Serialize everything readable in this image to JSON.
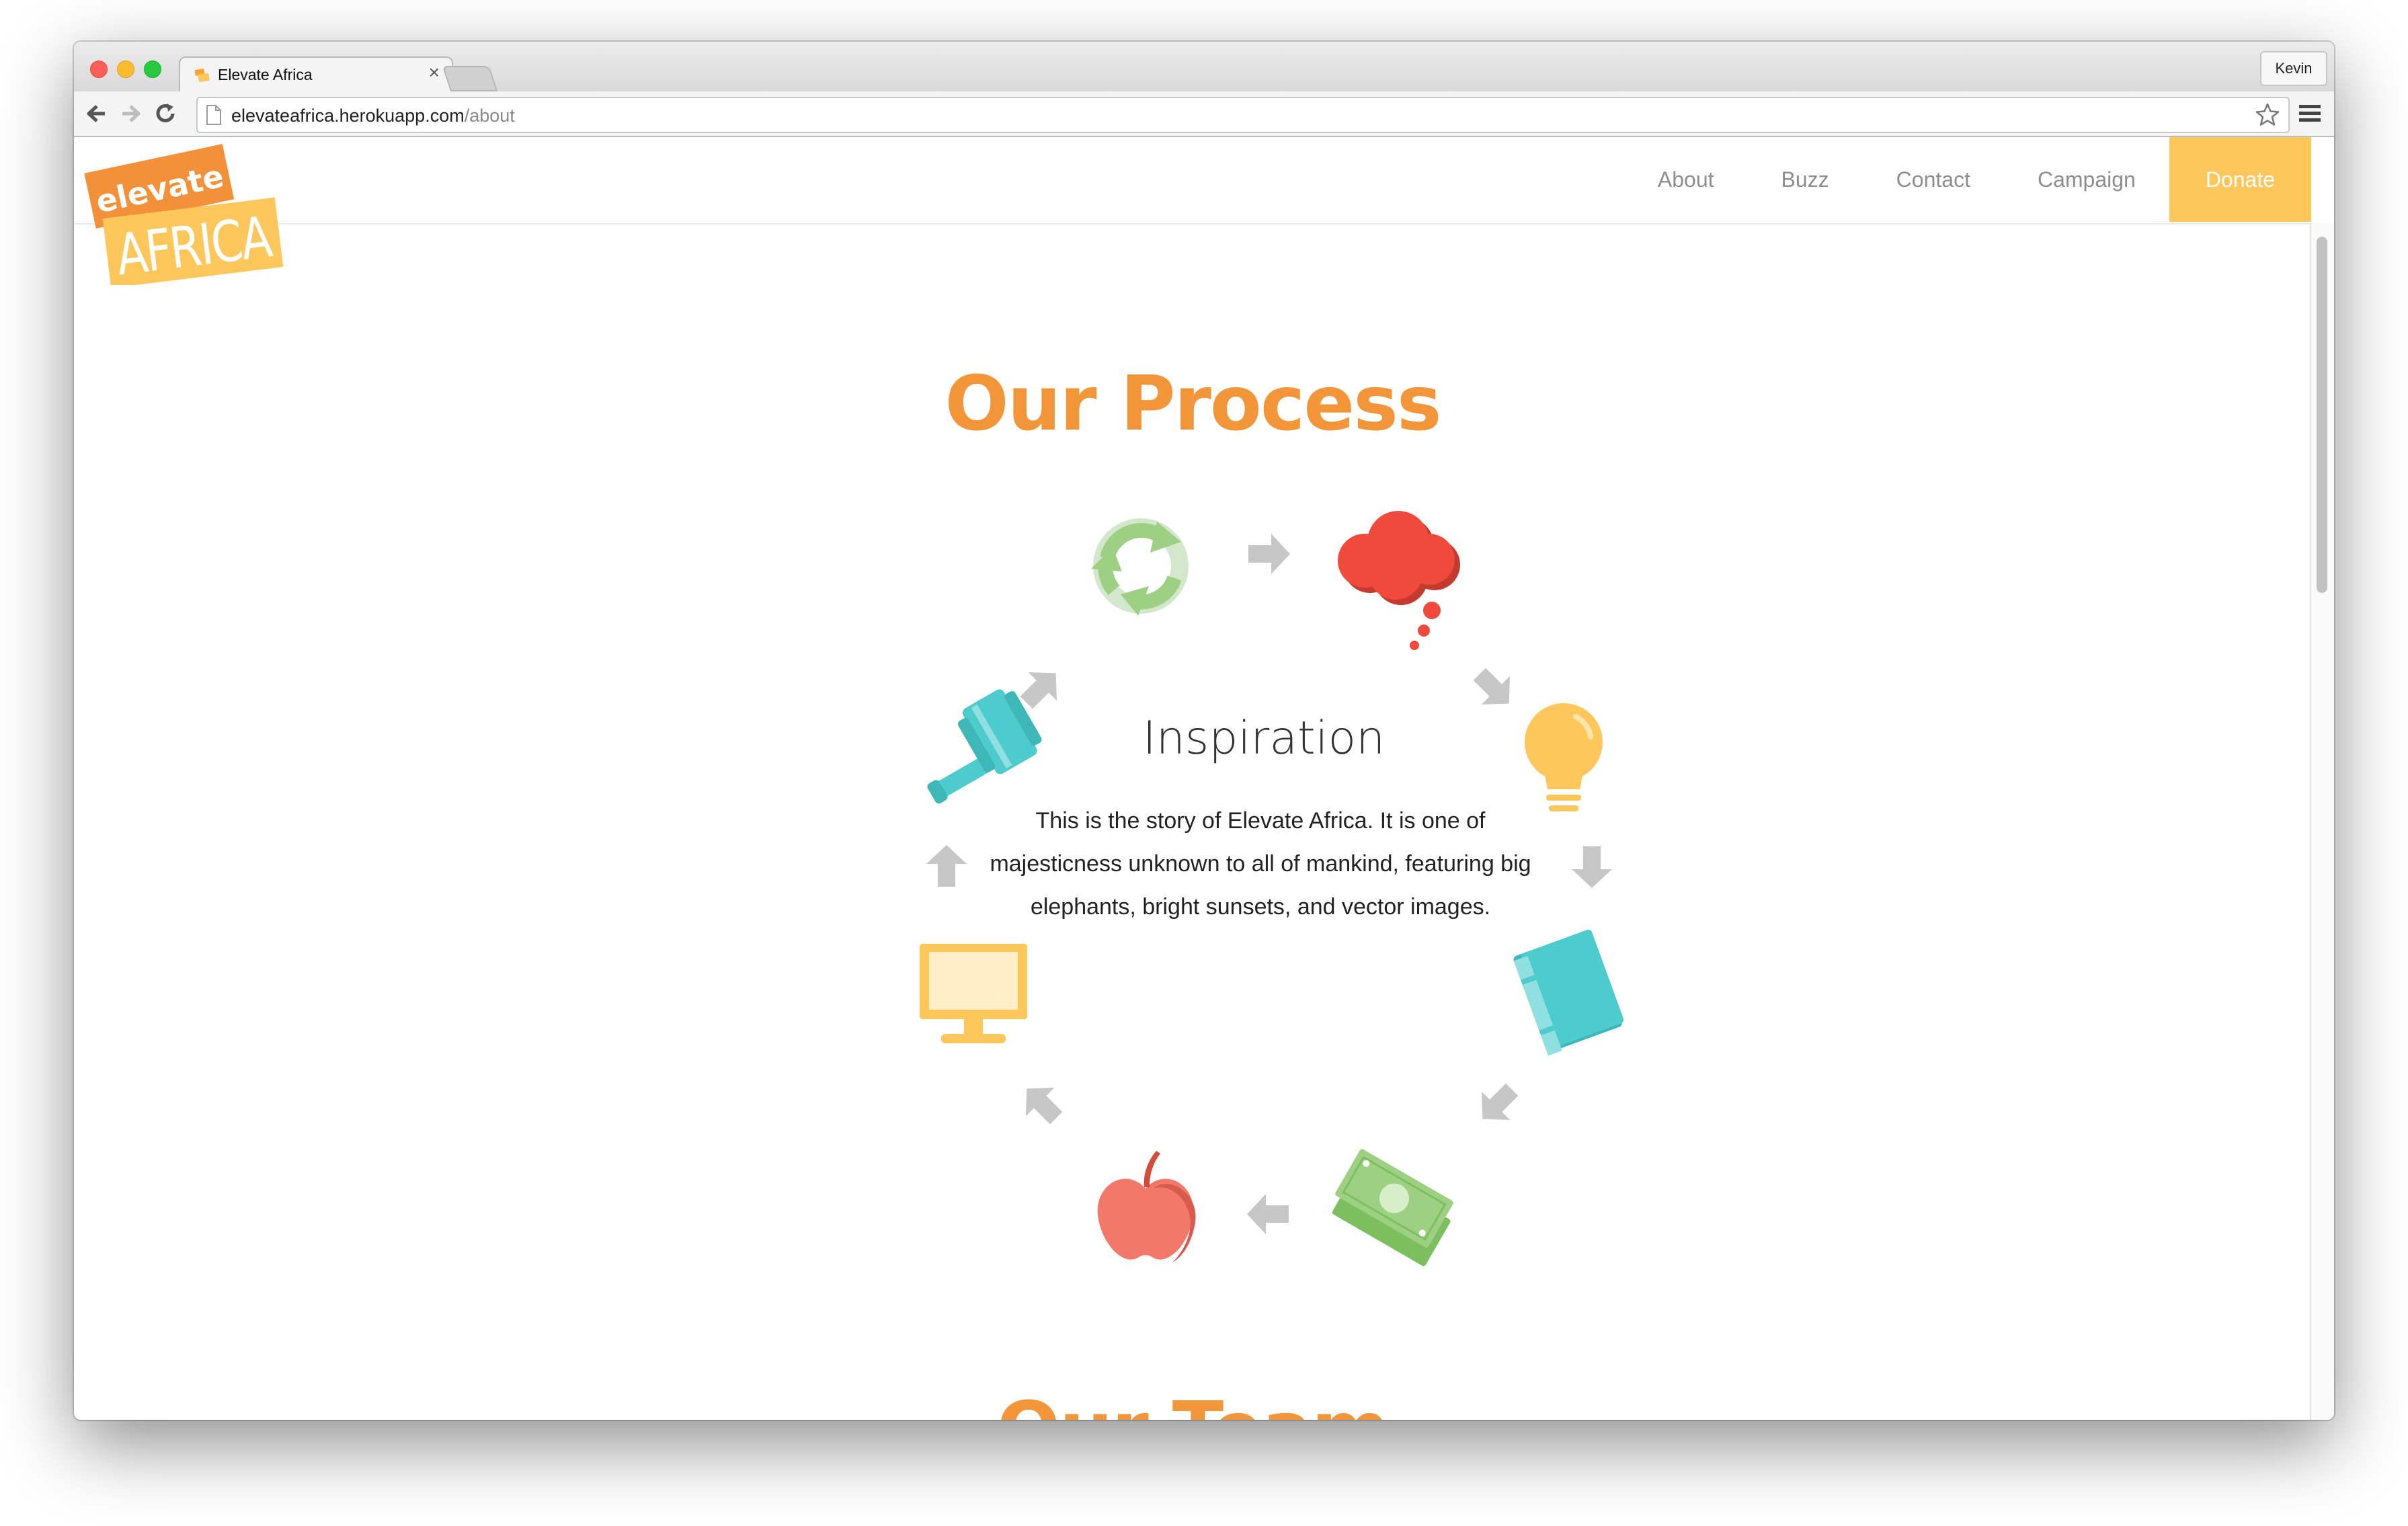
{
  "browser": {
    "tab_title": "Elevate Africa",
    "tab_close": "×",
    "profile_name": "Kevin",
    "url_host": "elevateafrica.herokuapp.com",
    "url_path": "/about"
  },
  "site": {
    "logo_line1": "elevate",
    "logo_line2": "AFRICA",
    "nav": {
      "about": "About",
      "buzz": "Buzz",
      "contact": "Contact",
      "campaign": "Campaign",
      "donate": "Donate"
    }
  },
  "process": {
    "title": "Our Process",
    "center_heading": "Inspiration",
    "center_body": "This is the story of Elevate Africa. It is one of majesticness unknown to all of mankind, featuring big elephants, bright sunsets, and vector images.",
    "steps": [
      {
        "icon": "recycle-icon"
      },
      {
        "icon": "thought-cloud-icon"
      },
      {
        "icon": "lightbulb-icon"
      },
      {
        "icon": "book-icon"
      },
      {
        "icon": "money-icon"
      },
      {
        "icon": "apple-icon"
      },
      {
        "icon": "monitor-icon"
      },
      {
        "icon": "gavel-icon"
      }
    ]
  },
  "team": {
    "title": "Our Team"
  },
  "colors": {
    "accent_orange": "#f29639",
    "donate_yellow": "#fec75c",
    "arrow_gray": "#c7c7c7",
    "red": "#ef4a3c",
    "teal": "#4ecbcc",
    "green": "#9ed083",
    "coral": "#f2786a"
  }
}
